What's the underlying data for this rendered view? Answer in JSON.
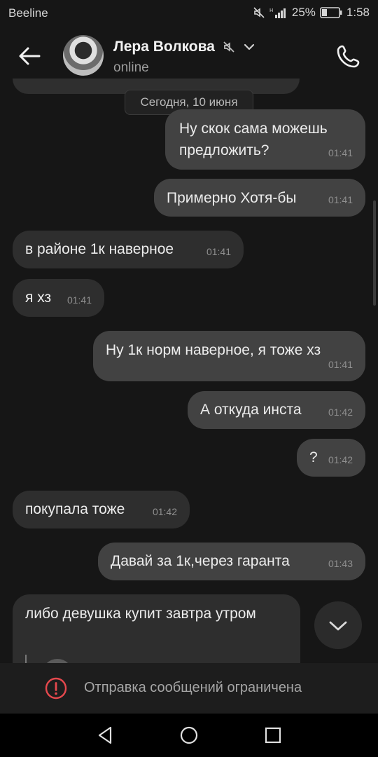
{
  "status_bar": {
    "carrier": "Beeline",
    "battery": "25%",
    "time": "1:58"
  },
  "header": {
    "name": "Лера Волкова",
    "status": "online",
    "muted": true
  },
  "date_separator": "Сегодня, 10 июня",
  "messages": [
    {
      "side": "out",
      "text": "Ну скок сама можешь предложить?",
      "time": "01:41"
    },
    {
      "side": "out",
      "text": "Примерно Хотя-бы",
      "time": "01:41"
    },
    {
      "side": "in",
      "text": "в районе 1к наверное",
      "time": "01:41"
    },
    {
      "side": "in",
      "text": "я хз",
      "time": "01:41"
    },
    {
      "side": "out",
      "text": "Ну 1к норм наверное, я тоже хз",
      "time": "01:41"
    },
    {
      "side": "out",
      "text": "А откуда инста",
      "time": "01:42"
    },
    {
      "side": "out",
      "text": "?",
      "time": "01:42"
    },
    {
      "side": "in",
      "text": "покупала тоже",
      "time": "01:42"
    },
    {
      "side": "out",
      "text": "Давай за 1к,через гаранта",
      "time": "01:43"
    },
    {
      "side": "in",
      "text": "либо девушка купит завтра утром",
      "time": ""
    }
  ],
  "restricted_notice": "Отправка сообщений ограничена",
  "colors": {
    "background": "#161616",
    "bubble_out": "#424242",
    "bubble_in": "#2e2e2e",
    "alert": "#e5484d"
  }
}
